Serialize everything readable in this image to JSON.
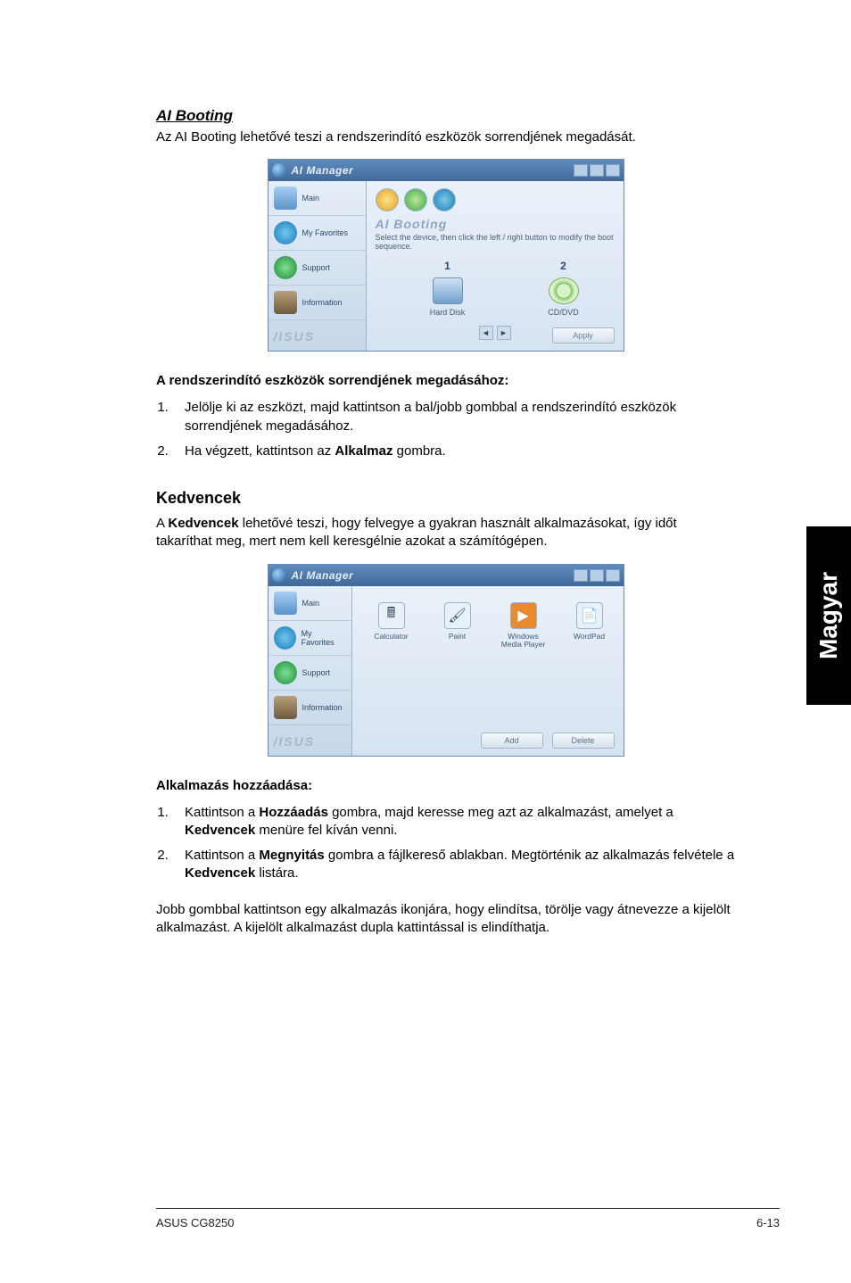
{
  "section_ai_booting": {
    "title": "AI Booting",
    "intro": "Az AI Booting lehetővé teszi a rendszerindító eszközök sorrendjének megadását.",
    "how_to_title": "A rendszerindító eszközök sorrendjének megadásához:",
    "steps": [
      "Jelölje ki az eszközt, majd kattintson a bal/jobb gombbal a rendszerindító eszközök sorrendjének megadásához.",
      "Ha végzett, kattintson az Alkalmaz gombra."
    ],
    "step2_prefix": "Ha végzett, kattintson az ",
    "step2_bold": "Alkalmaz",
    "step2_suffix": " gombra."
  },
  "section_favorites": {
    "title": "Kedvencek",
    "intro_prefix": "A ",
    "intro_bold": "Kedvencek",
    "intro_suffix": " lehetővé teszi, hogy felvegye a gyakran használt alkalmazásokat, így időt takaríthat meg, mert nem kell keresgélnie azokat a számítógépen.",
    "add_title": "Alkalmazás hozzáadása:",
    "step1_p1": "Kattintson a ",
    "step1_b1": "Hozzáadás",
    "step1_p2": " gombra, majd keresse meg azt az alkalmazást, amelyet a ",
    "step1_b2": "Kedvencek",
    "step1_p3": " menüre fel kíván venni.",
    "step2_p1": "Kattintson a ",
    "step2_b1": "Megnyitás",
    "step2_p2": " gombra a fájlkereső ablakban. Megtörténik az alkalmazás felvétele a ",
    "step2_b2": "Kedvencek",
    "step2_p3": " listára.",
    "outro": "Jobb gombbal kattintson egy alkalmazás ikonjára, hogy elindítsa, törölje vagy átnevezze a kijelölt alkalmazást. A kijelölt alkalmazást dupla kattintással is elindíthatja."
  },
  "screenshot_common": {
    "window_title": "AI Manager",
    "brand": "/ISUS",
    "sidebar": {
      "main": "Main",
      "favorites": "My Favorites",
      "support": "Support",
      "information": "Information"
    }
  },
  "screenshot_booting": {
    "panel_title": "AI Booting",
    "instruction": "Select the device, then click the left / right button to modify the boot sequence.",
    "slot1_num": "1",
    "slot1_label": "Hard Disk",
    "slot2_num": "2",
    "slot2_label": "CD/DVD",
    "apply": "Apply"
  },
  "screenshot_favorites": {
    "icons": [
      {
        "name": "Calculator"
      },
      {
        "name": "Paint"
      },
      {
        "name": "Windows Media Player"
      },
      {
        "name": "WordPad"
      }
    ],
    "add": "Add",
    "delete": "Delete"
  },
  "side_tab": "Magyar",
  "footer": {
    "left": "ASUS CG8250",
    "right": "6-13"
  }
}
